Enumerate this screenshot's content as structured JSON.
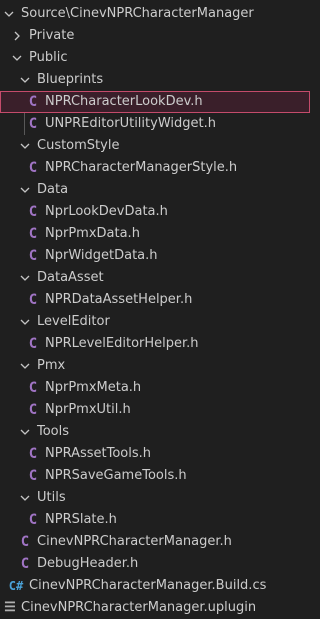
{
  "explorer": {
    "root": {
      "label": "Source\\CinevNPRCharacterManager"
    },
    "private_folder": {
      "label": "Private"
    },
    "public_folder": {
      "label": "Public"
    },
    "blueprints": {
      "label": "Blueprints",
      "files": [
        "NPRCharacterLookDev.h",
        "UNPREditorUtilityWidget.h"
      ]
    },
    "customstyle": {
      "label": "CustomStyle",
      "files": [
        "NPRCharacterManagerStyle.h"
      ]
    },
    "data": {
      "label": "Data",
      "files": [
        "NprLookDevData.h",
        "NprPmxData.h",
        "NprWidgetData.h"
      ]
    },
    "dataasset": {
      "label": "DataAsset",
      "files": [
        "NPRDataAssetHelper.h"
      ]
    },
    "leveleditor": {
      "label": "LevelEditor",
      "files": [
        "NPRLevelEditorHelper.h"
      ]
    },
    "pmx": {
      "label": "Pmx",
      "files": [
        "NprPmxMeta.h",
        "NprPmxUtil.h"
      ]
    },
    "tools": {
      "label": "Tools",
      "files": [
        "NPRAssetTools.h",
        "NPRSaveGameTools.h"
      ]
    },
    "utils": {
      "label": "Utils",
      "files": [
        "NPRSlate.h"
      ]
    },
    "public_files": [
      "CinevNPRCharacterManager.h",
      "DebugHeader.h"
    ],
    "build_file": {
      "label": "CinevNPRCharacterManager.Build.cs",
      "icon_text": "C#"
    },
    "uplugin_file": {
      "label": "CinevNPRCharacterManager.uplugin"
    },
    "c_icon_text": "C",
    "selected_file": "NPRCharacterLookDev.h",
    "colors": {
      "background": "#1f1f1f",
      "text": "#cccccc",
      "cpp_header_icon": "#a074c4",
      "csharp_icon": "#4aa2d8",
      "selection_border": "#c44b6b",
      "selection_fill": "#3a1f2a",
      "indent_guide": "#585858"
    }
  }
}
